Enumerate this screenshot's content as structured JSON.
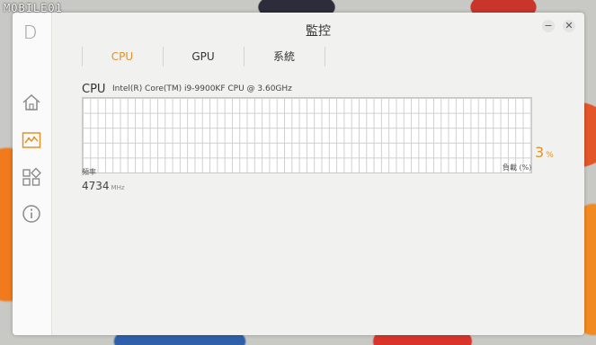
{
  "watermark": "MOBILE01",
  "app": {
    "logo": "D",
    "title": "監控"
  },
  "window_buttons": {
    "minimize": "−",
    "close": "✕"
  },
  "sidebar": {
    "items": [
      {
        "name": "home",
        "icon": "home-icon"
      },
      {
        "name": "monitor",
        "icon": "activity-icon",
        "active": true
      },
      {
        "name": "apps",
        "icon": "grid-icon"
      },
      {
        "name": "info",
        "icon": "info-icon"
      }
    ]
  },
  "tabs": [
    {
      "label": "CPU",
      "active": true
    },
    {
      "label": "GPU",
      "active": false
    },
    {
      "label": "系統",
      "active": false
    }
  ],
  "cpu": {
    "label": "CPU",
    "model": "Intel(R) Core(TM) i9-9900KF CPU @ 3.60GHz",
    "load_value": "3",
    "load_unit": "%",
    "load_label": "負載 (%)",
    "freq_label": "頻率",
    "freq_value": "4734",
    "freq_unit": "MHz"
  },
  "colors": {
    "accent": "#e0932a",
    "icon": "#8a8a8a",
    "active_icon": "#e0932a"
  }
}
